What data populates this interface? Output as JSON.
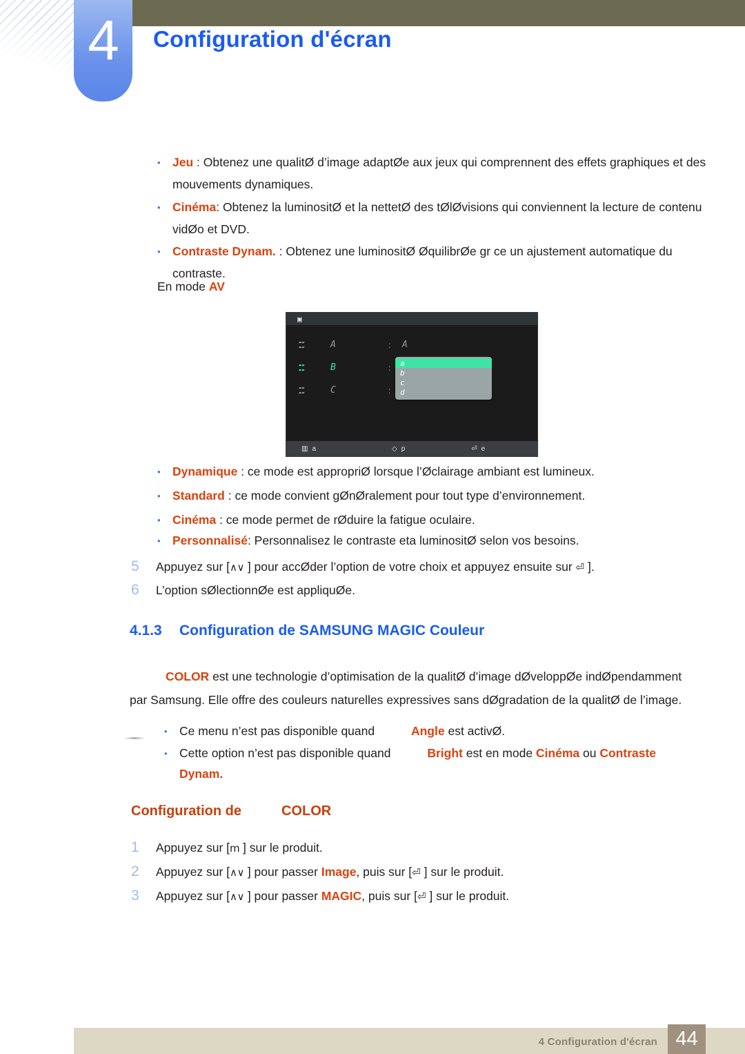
{
  "header": {
    "chapter_number": "4",
    "chapter_title": "Configuration d'écran",
    "colors": {
      "title_blue": "#1a5cf0",
      "tab_blue": "#6a92ea",
      "olive": "#6d6a52"
    }
  },
  "mode_bullets": [
    {
      "term": "Jeu",
      "rest": " : Obtenez une qualitØ d’image adaptØe aux jeux qui comprennent des effets graphiques et des mouvements dynamiques."
    },
    {
      "term": "Cinéma",
      "rest": ": Obtenez la luminositØ et la nettetØ des tØlØvisions qui conviennent   la lecture de contenu vidØo et DVD."
    },
    {
      "term": "Contraste Dynam.",
      "rest": " : Obtenez une luminositØ ØquilibrØe gr ce   un ajustement automatique du contraste."
    }
  ],
  "av_line": {
    "prefix": "En mode ",
    "keyword": "AV"
  },
  "osd": {
    "top_glyph": "▣",
    "rows": [
      {
        "icon": "SAMSUNG MAGIC",
        "label": "A",
        "colon": ":",
        "value": "A",
        "selected": false
      },
      {
        "icon": "SAMSUNG MAGIC",
        "label": "B",
        "colon": ":",
        "value": "",
        "selected": true
      },
      {
        "icon": "SAMSUNG MAGIC",
        "label": "C",
        "colon": ":",
        "value": "",
        "selected": false
      }
    ],
    "dropdown": {
      "items": [
        "a",
        "b",
        "c",
        "d"
      ],
      "highlight_index": 0,
      "highlight_color": "#3fe3a6",
      "body_color": "#9aa6a6"
    },
    "bottom_bar": [
      {
        "icon": "menu-bars-icon",
        "label": "a"
      },
      {
        "icon": "diamond-icon",
        "label": "p"
      },
      {
        "icon": "return-icon",
        "label": "e"
      }
    ]
  },
  "preset_bullets": [
    {
      "term": "Dynamique",
      "rest": " : ce mode est appropriØ lorsque l’Øclairage ambiant est lumineux."
    },
    {
      "term": "Standard",
      "rest": " : ce mode convient gØnØralement pour tout type d’environnement."
    },
    {
      "term": "Cinéma",
      "rest": " : ce mode permet de rØduire la fatigue oculaire."
    },
    {
      "term": "Personnalisé",
      "rest": ": Personnalisez le contraste eta luminositØ selon vos besoins."
    }
  ],
  "steps_upper": [
    {
      "num": "5",
      "part1": "Appuyez sur [",
      "glyph1": "∧∨",
      "part2": " ] pour accØder l’option de votre choix et appuyez ensuite sur ",
      "glyph2": "⏎",
      "part3": " ]."
    },
    {
      "num": "6",
      "part1": "L’option sØlectionnØe est appliquØe.",
      "glyph1": "",
      "part2": "",
      "glyph2": "",
      "part3": ""
    }
  ],
  "section": {
    "number": "4.1.3",
    "title": "Configuration de SAMSUNG MAGIC Couleur"
  },
  "intro": {
    "keyword": "COLOR",
    "line1_rest": " est une technologie d’optimisation de la qualitØ d’image dØveloppØe indØpendamment",
    "line2": "par Samsung. Elle offre des couleurs naturelles expressives sans dØgradation de la qualitØ de l’image."
  },
  "notes": [
    {
      "pre": "Ce menu n’est pas disponible quand ",
      "kw1": "Angle",
      "mid": " est activØ.",
      "kw2": "",
      "mid2": "",
      "kw3": "",
      "mid3": "",
      "kw4": ""
    },
    {
      "pre": "Cette option n’est pas disponible quand ",
      "kw1": "Bright",
      "mid": " est en mode ",
      "kw2": "Cinéma",
      "mid2": " ou ",
      "kw3": "Contraste",
      "mid3": "",
      "kw4": "Dynam."
    }
  ],
  "subheading": {
    "prefix": "Configuration de",
    "keyword": "COLOR"
  },
  "steps_lower": [
    {
      "num": "1",
      "part1": "Appuyez sur [",
      "glyph1": "m",
      "part2": "  ] sur le produit.",
      "kw": "",
      "part3": "",
      "glyph2": "",
      "part4": ""
    },
    {
      "num": "2",
      "part1": "Appuyez sur [",
      "glyph1": "∧∨",
      "part2": " ] pour passer  ",
      "kw": "Image",
      "part3": ", puis sur [",
      "glyph2": "⏎",
      "part4": " ] sur le produit."
    },
    {
      "num": "3",
      "part1": "Appuyez sur [",
      "glyph1": "∧∨",
      "part2": " ] pour passer  ",
      "kw": "MAGIC",
      "part3": ", puis sur [",
      "glyph2": "⏎",
      "part4": " ] sur le produit."
    }
  ],
  "footer": {
    "text": "4 Configuration d'écran",
    "page": "44"
  }
}
